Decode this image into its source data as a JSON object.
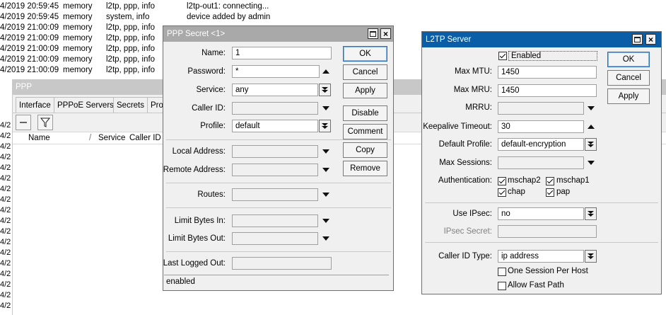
{
  "log": {
    "rows": [
      {
        "time": "4/2019 20:59:45",
        "buffer": "memory",
        "topics": "l2tp, ppp, info",
        "message": "l2tp-out1: connecting..."
      },
      {
        "time": "4/2019 20:59:45",
        "buffer": "memory",
        "topics": "system, info",
        "message": "device added by admin"
      },
      {
        "time": "4/2019 21:00:09",
        "buffer": "memory",
        "topics": "l2tp, ppp, info",
        "message": ""
      },
      {
        "time": "4/2019 21:00:09",
        "buffer": "memory",
        "topics": "l2tp, ppp, info",
        "message": ""
      },
      {
        "time": "4/2019 21:00:09",
        "buffer": "memory",
        "topics": "l2tp, ppp, info",
        "message": ""
      },
      {
        "time": "4/2019 21:00:09",
        "buffer": "memory",
        "topics": "l2tp, ppp, info",
        "message": ""
      },
      {
        "time": "4/2019 21:00:09",
        "buffer": "memory",
        "topics": "l2tp, ppp, info",
        "message": ""
      }
    ],
    "left_fragments": [
      "4/2",
      "4/2",
      "4/2",
      "4/2",
      "4/2",
      "4/2",
      "4/2",
      "4/2",
      "4/2",
      "4/2",
      "4/2",
      "4/2",
      "4/2",
      "4/2",
      "4/2",
      "4/2",
      "4/2",
      "4/2",
      "4/2"
    ]
  },
  "ppp_window": {
    "title": "PPP",
    "tabs": [
      "Interface",
      "PPPoE Servers",
      "Secrets",
      "Prof"
    ],
    "columns": [
      "Name",
      "/",
      "Service",
      "Caller ID"
    ]
  },
  "ppp_secret": {
    "title": "PPP Secret <1>",
    "fields": {
      "name": {
        "label": "Name:",
        "value": "1"
      },
      "password": {
        "label": "Password:",
        "value": "*"
      },
      "service": {
        "label": "Service:",
        "value": "any"
      },
      "caller_id": {
        "label": "Caller ID:",
        "value": ""
      },
      "profile": {
        "label": "Profile:",
        "value": "default"
      },
      "local_address": {
        "label": "Local Address:",
        "value": ""
      },
      "remote_address": {
        "label": "Remote Address:",
        "value": ""
      },
      "routes": {
        "label": "Routes:",
        "value": ""
      },
      "limit_bytes_in": {
        "label": "Limit Bytes In:",
        "value": ""
      },
      "limit_bytes_out": {
        "label": "Limit Bytes Out:",
        "value": ""
      },
      "last_logged_out": {
        "label": "Last Logged Out:",
        "value": ""
      }
    },
    "buttons": {
      "ok": "OK",
      "cancel": "Cancel",
      "apply": "Apply",
      "disable": "Disable",
      "comment": "Comment",
      "copy": "Copy",
      "remove": "Remove"
    },
    "status": "enabled"
  },
  "l2tp_server": {
    "title": "L2TP Server",
    "enabled": {
      "label": "Enabled",
      "checked": true
    },
    "fields": {
      "max_mtu": {
        "label": "Max MTU:",
        "value": "1450"
      },
      "max_mru": {
        "label": "Max MRU:",
        "value": "1450"
      },
      "mrru": {
        "label": "MRRU:",
        "value": ""
      },
      "keepalive_timeout": {
        "label": "Keepalive Timeout:",
        "value": "30"
      },
      "default_profile": {
        "label": "Default Profile:",
        "value": "default-encryption"
      },
      "max_sessions": {
        "label": "Max Sessions:",
        "value": ""
      },
      "use_ipsec": {
        "label": "Use IPsec:",
        "value": "no"
      },
      "ipsec_secret": {
        "label": "IPsec Secret:",
        "value": ""
      },
      "caller_id_type": {
        "label": "Caller ID Type:",
        "value": "ip address"
      }
    },
    "authentication": {
      "label": "Authentication:",
      "options": [
        {
          "label": "mschap2",
          "checked": true
        },
        {
          "label": "mschap1",
          "checked": true
        },
        {
          "label": "chap",
          "checked": true
        },
        {
          "label": "pap",
          "checked": true
        }
      ]
    },
    "one_session_per_host": {
      "label": "One Session Per Host",
      "checked": false
    },
    "allow_fast_path": {
      "label": "Allow Fast Path",
      "checked": false
    },
    "buttons": {
      "ok": "OK",
      "cancel": "Cancel",
      "apply": "Apply"
    }
  }
}
